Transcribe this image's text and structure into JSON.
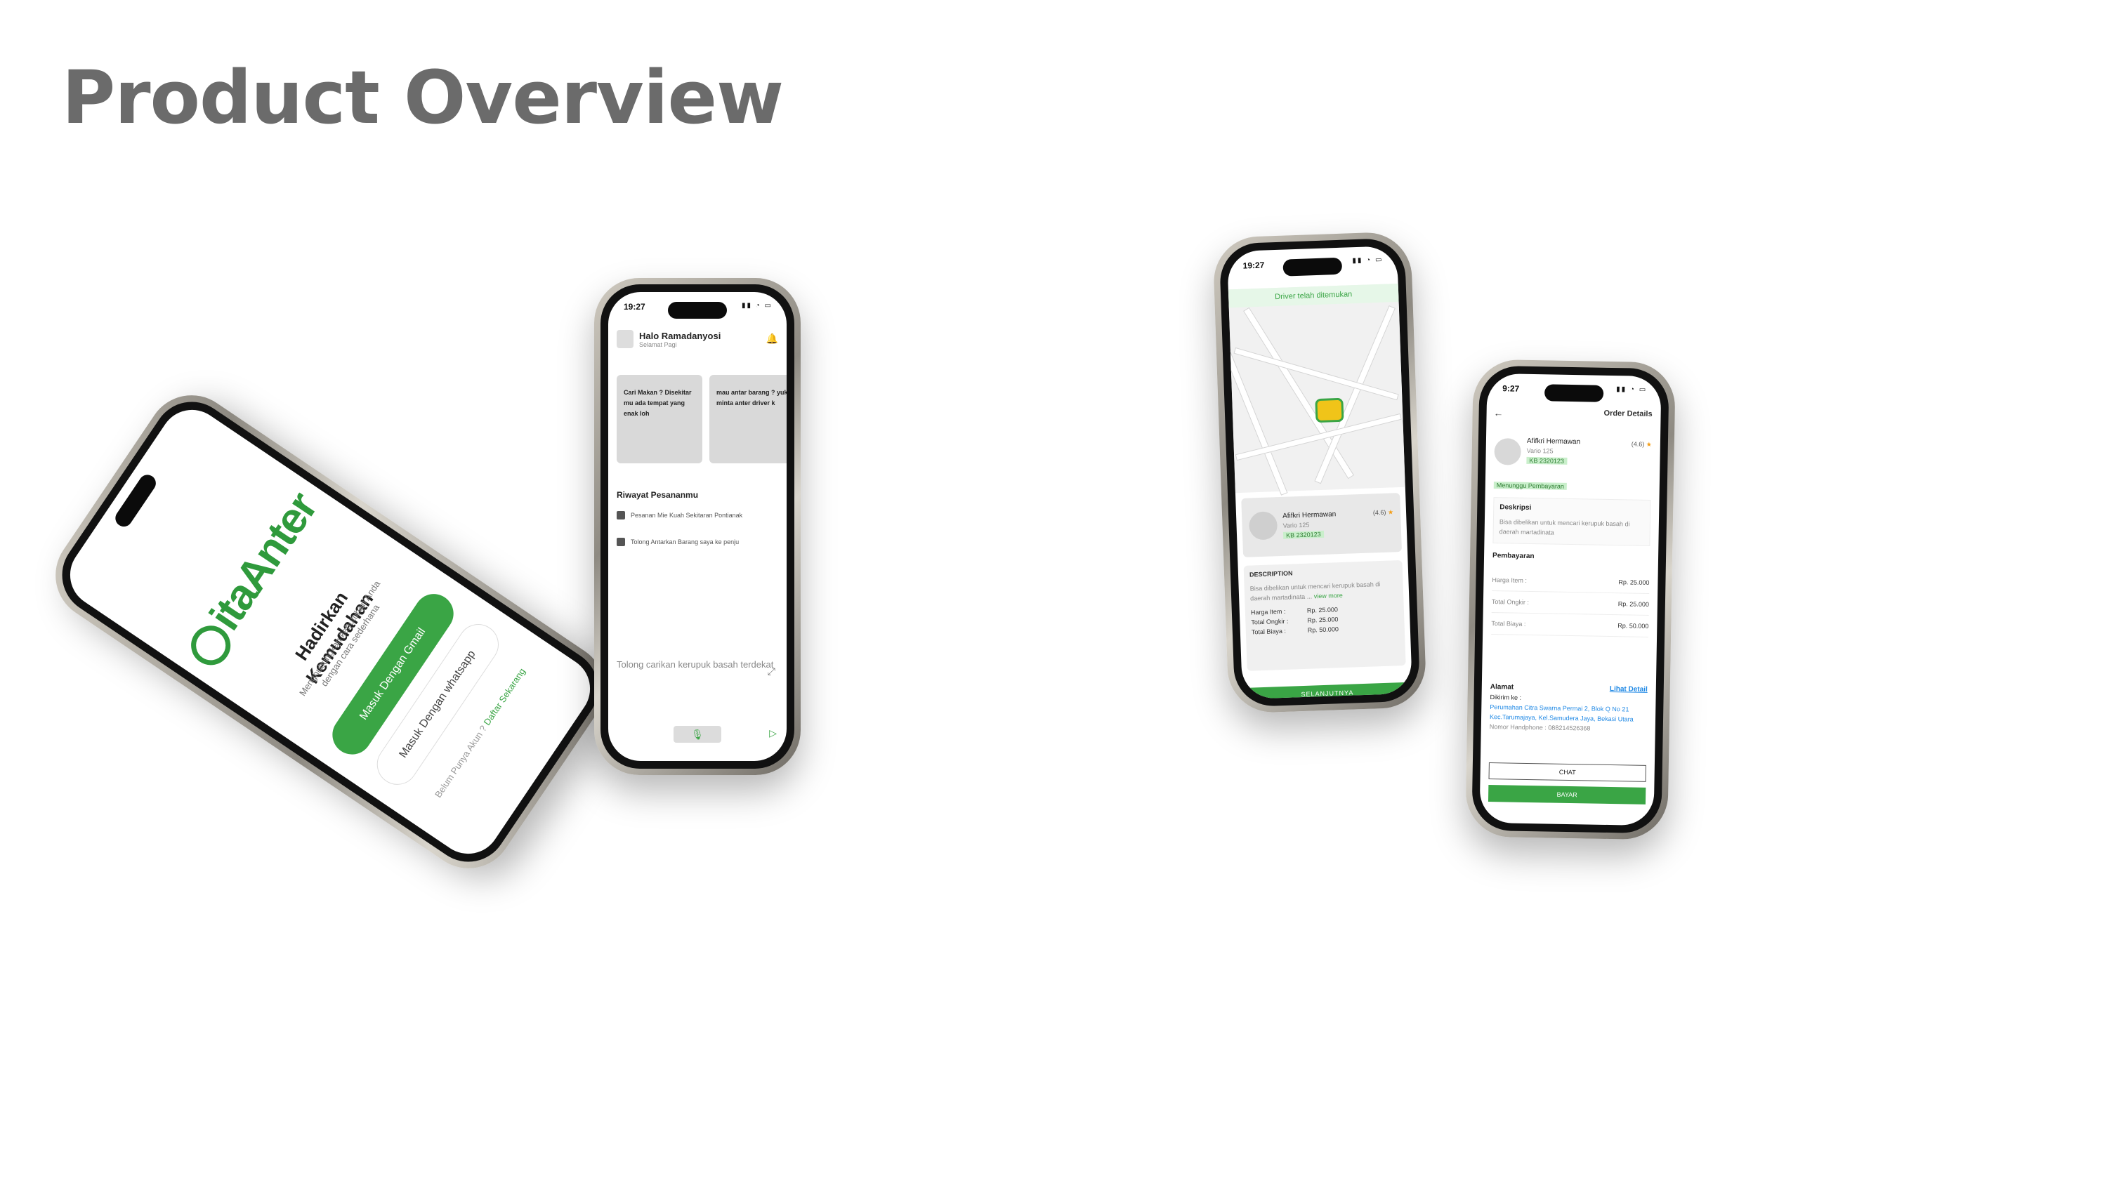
{
  "page": {
    "title": "Product Overview"
  },
  "login": {
    "logo_text": "itaAnter",
    "headline": "Hadirkan Kemudahan",
    "subtext": "Menghubungkan kebutuhan Anda dengan cara sederhana",
    "gmail_button": "Masuk Dengan Gmail",
    "whatsapp_button": "Masuk Dengan whatsapp",
    "footer_prefix": "Belum Punya Akun ?",
    "footer_link": "Daftar Sekarang"
  },
  "home": {
    "time": "19:27",
    "user_name": "Halo Ramadanyosi",
    "greeting": "Selamat Pagi",
    "card1": "Cari Makan ? Disekitar mu ada tempat yang enak loh",
    "card2": "mau antar barang ? yuk minta anter driver k",
    "section_title": "Riwayat Pesananmu",
    "history1": "Pesanan Mie Kuah Sekitaran Pontianak",
    "history2": "Tolong Antarkan Barang saya ke penju",
    "chat_placeholder": "Tolong carikan kerupuk basah terdekat"
  },
  "map_screen": {
    "time": "19:27",
    "banner": "Driver telah ditemukan",
    "driver_name": "Afifkri Hermawan",
    "vehicle": "Vario 125",
    "plate": "KB 2320123",
    "rating": "(4.6)",
    "desc_label": "DESCRIPTION",
    "desc_text": "Bisa dibelikan untuk mencari kerupuk basah di daerah martadinata ...",
    "view_more": "view more",
    "rows": [
      {
        "k": "Harga Item :",
        "v": "Rp. 25.000"
      },
      {
        "k": "Total Ongkir :",
        "v": "Rp. 25.000"
      },
      {
        "k": "Total Biaya :",
        "v": "Rp. 50.000"
      }
    ],
    "button": "SELANJUTNYA"
  },
  "order": {
    "time": "9:27",
    "title": "Order Details",
    "driver_name": "Afifkri Hermawan",
    "vehicle": "Vario 125",
    "plate": "KB 2320123",
    "rating": "(4.6)",
    "status": "Menunggu Pembayaran",
    "desc_label": "Deskripsi",
    "desc_text": "Bisa dibelikan untuk mencari kerupuk basah di daerah martadinata",
    "pay_label": "Pembayaran",
    "pay_rows": [
      {
        "k": "Harga Item :",
        "v": "Rp. 25.000"
      },
      {
        "k": "Total Ongkir :",
        "v": "Rp. 25.000"
      },
      {
        "k": "Total Biaya :",
        "v": "Rp. 50.000"
      }
    ],
    "addr_label": "Alamat",
    "addr_link": "Lihat Detail",
    "addr_to": "Dikirim ke :",
    "addr_text": "Perumahan Citra Swarna Permai 2, Blok Q No 21 Kec.Tarumajaya, Kel.Samudera Jaya, Bekasi Utara",
    "phone": "Nomor Handphone : 088214526368",
    "chat_button": "CHAT",
    "pay_button": "BAYAR"
  },
  "colors": {
    "accent": "#3aa545",
    "title_gray": "#6b6b6b",
    "link_blue": "#1e88e5"
  }
}
